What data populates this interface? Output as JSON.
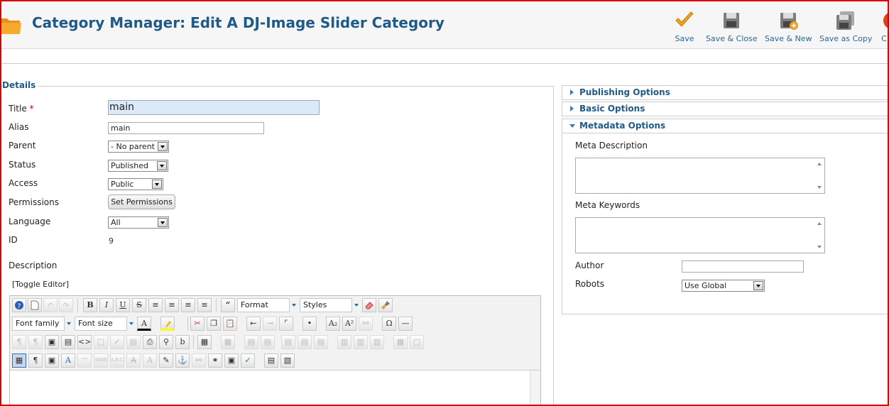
{
  "header": {
    "title": "Category Manager: Edit A DJ-Image Slider Category",
    "toolbar": {
      "save": "Save",
      "save_close": "Save & Close",
      "save_new": "Save & New",
      "save_copy": "Save as Copy",
      "close": "C"
    }
  },
  "details": {
    "legend": "Details",
    "title_label": "Title",
    "required_mark": "*",
    "title_value": "main",
    "alias_label": "Alias",
    "alias_value": "main",
    "parent_label": "Parent",
    "parent_value": "- No parent -",
    "status_label": "Status",
    "status_value": "Published",
    "access_label": "Access",
    "access_value": "Public",
    "permissions_label": "Permissions",
    "permissions_button": "Set Permissions",
    "language_label": "Language",
    "language_value": "All",
    "id_label": "ID",
    "id_value": "9",
    "description_label": "Description",
    "toggle_editor": "[Toggle Editor]"
  },
  "editor": {
    "format_label": "Format",
    "styles_label": "Styles",
    "font_family_label": "Font family",
    "font_size_label": "Font size",
    "bold": "B",
    "italic": "I",
    "underline": "U",
    "strike": "S"
  },
  "panels": {
    "publishing": "Publishing Options",
    "basic": "Basic Options",
    "metadata": "Metadata Options",
    "meta_description_label": "Meta Description",
    "meta_keywords_label": "Meta Keywords",
    "author_label": "Author",
    "robots_label": "Robots",
    "robots_value": "Use Global"
  },
  "colors": {
    "title": "#205a86",
    "frame": "#d40000",
    "save_check": "#f0a020"
  }
}
